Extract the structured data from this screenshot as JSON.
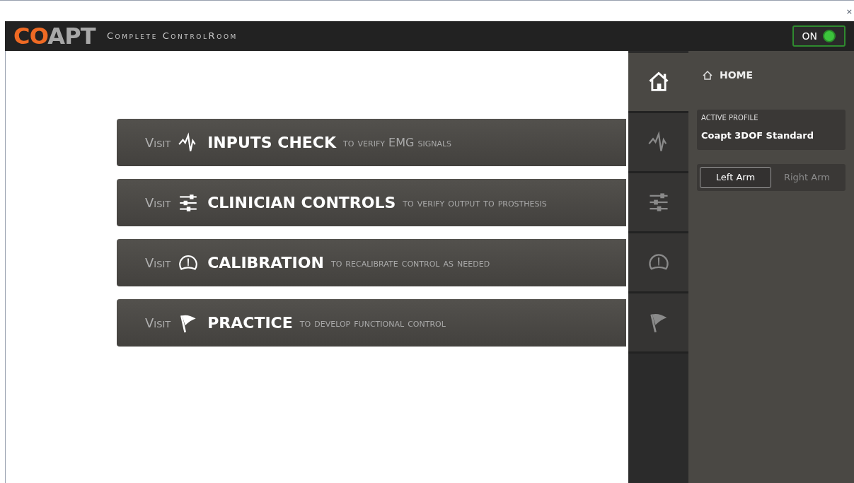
{
  "window": {
    "close": "×"
  },
  "header": {
    "logo_colored": "CO",
    "logo_rest": "APT",
    "title": "Complete ControlRoom",
    "power": {
      "label": "ON",
      "on": true
    }
  },
  "cards": [
    {
      "kind": "pulse",
      "prefix": "Visit",
      "title": "INPUTS CHECK",
      "suffix": "to verify EMG signals"
    },
    {
      "kind": "sliders",
      "prefix": "Visit",
      "title": "CLINICIAN CONTROLS",
      "suffix": "to verify output to prosthesis"
    },
    {
      "kind": "gauge",
      "prefix": "Visit",
      "title": "CALIBRATION",
      "suffix": "to recalibrate control as needed"
    },
    {
      "kind": "flag",
      "prefix": "Visit",
      "title": "PRACTICE",
      "suffix": "to develop functional control"
    }
  ],
  "nav_tabs": [
    {
      "kind": "home",
      "selected": true
    },
    {
      "kind": "pulse",
      "selected": false
    },
    {
      "kind": "sliders",
      "selected": false
    },
    {
      "kind": "gauge",
      "selected": false
    },
    {
      "kind": "flag",
      "selected": false
    }
  ],
  "panel": {
    "title": "HOME",
    "profile_label": "ACTIVE PROFILE",
    "profile_name": "Coapt 3DOF Standard",
    "arms": [
      {
        "label": "Left Arm",
        "selected": true
      },
      {
        "label": "Right Arm",
        "selected": false
      }
    ]
  }
}
